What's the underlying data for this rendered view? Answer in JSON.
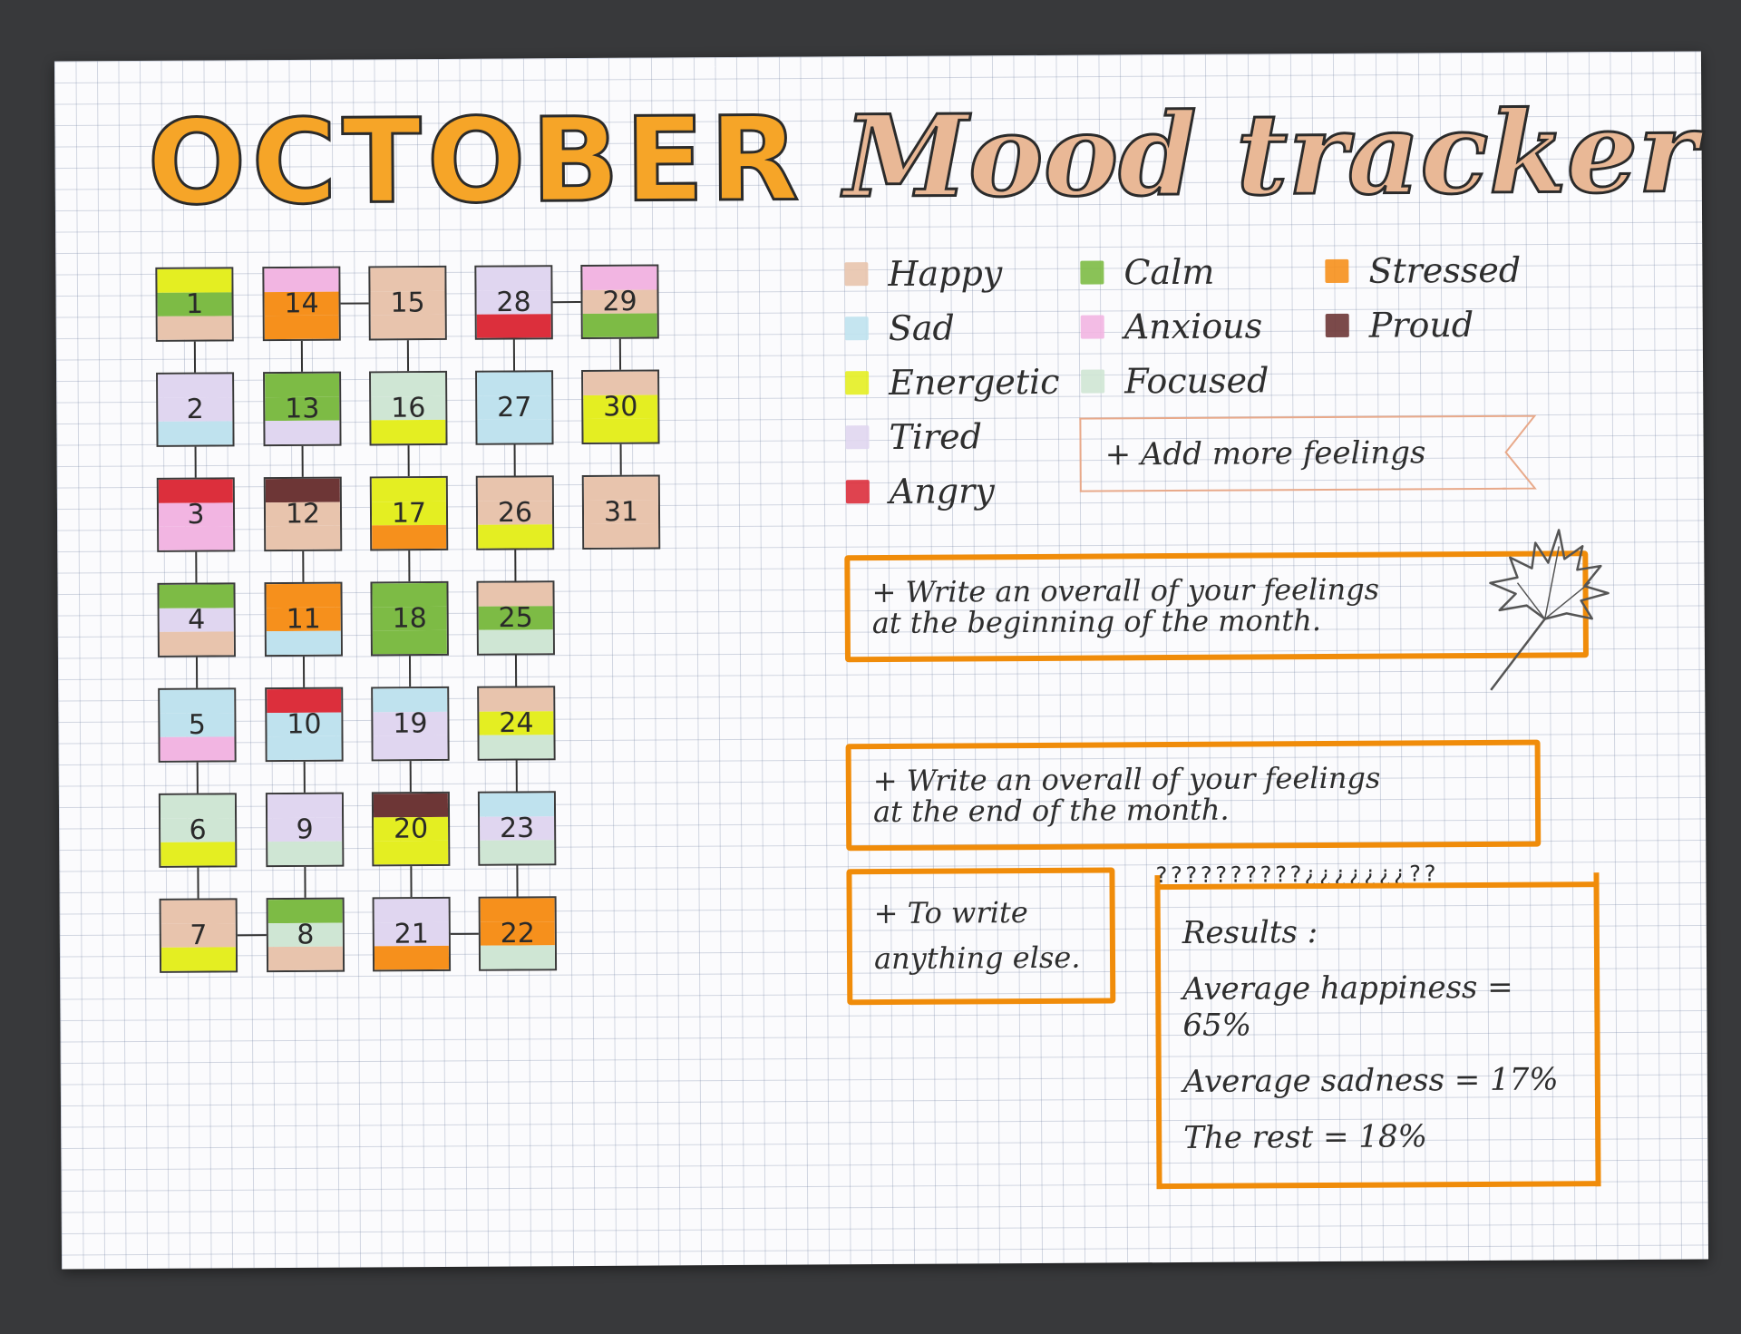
{
  "title": {
    "month": "OCTOBER",
    "subtitle": "Mood tracker"
  },
  "moods": {
    "happy": {
      "label": "Happy",
      "color": "#e8c4ad"
    },
    "sad": {
      "label": "Sad",
      "color": "#bfe2ee"
    },
    "energetic": {
      "label": "Energetic",
      "color": "#e4ee22"
    },
    "tired": {
      "label": "Tired",
      "color": "#e0d6f0"
    },
    "angry": {
      "label": "Angry",
      "color": "#dc2f3c"
    },
    "calm": {
      "label": "Calm",
      "color": "#7dbb45"
    },
    "anxious": {
      "label": "Anxious",
      "color": "#f2b5e2"
    },
    "focused": {
      "label": "Focused",
      "color": "#cfe6d4"
    },
    "stressed": {
      "label": "Stressed",
      "color": "#f6901c"
    },
    "proud": {
      "label": "Proud",
      "color": "#6d3636"
    }
  },
  "legend_order": [
    "happy",
    "sad",
    "energetic",
    "tired",
    "angry",
    "calm",
    "anxious",
    "focused",
    "stressed",
    "proud"
  ],
  "days": [
    {
      "day": "1",
      "moods": [
        "energetic",
        "calm",
        "happy"
      ]
    },
    {
      "day": "2",
      "moods": [
        "tired",
        "tired",
        "sad"
      ]
    },
    {
      "day": "3",
      "moods": [
        "angry",
        "anxious",
        "anxious"
      ]
    },
    {
      "day": "4",
      "moods": [
        "calm",
        "tired",
        "happy"
      ]
    },
    {
      "day": "5",
      "moods": [
        "sad",
        "sad",
        "anxious"
      ]
    },
    {
      "day": "6",
      "moods": [
        "focused",
        "focused",
        "energetic"
      ]
    },
    {
      "day": "7",
      "moods": [
        "happy",
        "happy",
        "energetic"
      ]
    },
    {
      "day": "8",
      "moods": [
        "calm",
        "focused",
        "happy"
      ]
    },
    {
      "day": "9",
      "moods": [
        "tired",
        "tired",
        "focused"
      ]
    },
    {
      "day": "10",
      "moods": [
        "angry",
        "sad",
        "sad"
      ]
    },
    {
      "day": "11",
      "moods": [
        "stressed",
        "stressed",
        "sad"
      ]
    },
    {
      "day": "12",
      "moods": [
        "proud",
        "happy",
        "happy"
      ]
    },
    {
      "day": "13",
      "moods": [
        "calm",
        "calm",
        "tired"
      ]
    },
    {
      "day": "14",
      "moods": [
        "anxious",
        "stressed",
        "stressed"
      ]
    },
    {
      "day": "15",
      "moods": [
        "happy",
        "happy",
        "happy"
      ]
    },
    {
      "day": "16",
      "moods": [
        "focused",
        "focused",
        "energetic"
      ]
    },
    {
      "day": "17",
      "moods": [
        "energetic",
        "energetic",
        "stressed"
      ]
    },
    {
      "day": "18",
      "moods": [
        "calm",
        "calm",
        "calm"
      ]
    },
    {
      "day": "19",
      "moods": [
        "sad",
        "tired",
        "tired"
      ]
    },
    {
      "day": "20",
      "moods": [
        "proud",
        "energetic",
        "energetic"
      ]
    },
    {
      "day": "21",
      "moods": [
        "tired",
        "tired",
        "stressed"
      ]
    },
    {
      "day": "22",
      "moods": [
        "stressed",
        "stressed",
        "focused"
      ]
    },
    {
      "day": "23",
      "moods": [
        "sad",
        "tired",
        "focused"
      ]
    },
    {
      "day": "24",
      "moods": [
        "happy",
        "energetic",
        "focused"
      ]
    },
    {
      "day": "25",
      "moods": [
        "happy",
        "calm",
        "focused"
      ]
    },
    {
      "day": "26",
      "moods": [
        "happy",
        "happy",
        "energetic"
      ]
    },
    {
      "day": "27",
      "moods": [
        "sad",
        "sad",
        "sad"
      ]
    },
    {
      "day": "28",
      "moods": [
        "tired",
        "tired",
        "angry"
      ]
    },
    {
      "day": "29",
      "moods": [
        "anxious",
        "happy",
        "calm"
      ]
    },
    {
      "day": "30",
      "moods": [
        "happy",
        "energetic",
        "energetic"
      ]
    },
    {
      "day": "31",
      "moods": [
        "happy",
        "happy",
        "happy"
      ]
    }
  ],
  "add_more": "+ Add more feelings",
  "notes": {
    "beginning": {
      "line1": "+ Write an overall of your feelings",
      "line2": "at the beginning of the month."
    },
    "end": {
      "line1": "+ Write an overall of your feelings",
      "line2": "at the end of the month."
    },
    "other": {
      "line1": "+ To write",
      "line2": "anything else."
    }
  },
  "results": {
    "heading": "Results :",
    "header_marks": "??????????¿¿¿¿¿¿¿??",
    "lines": [
      "Average happiness = 65%",
      "Average sadness = 17%",
      "The rest = 18%"
    ]
  }
}
